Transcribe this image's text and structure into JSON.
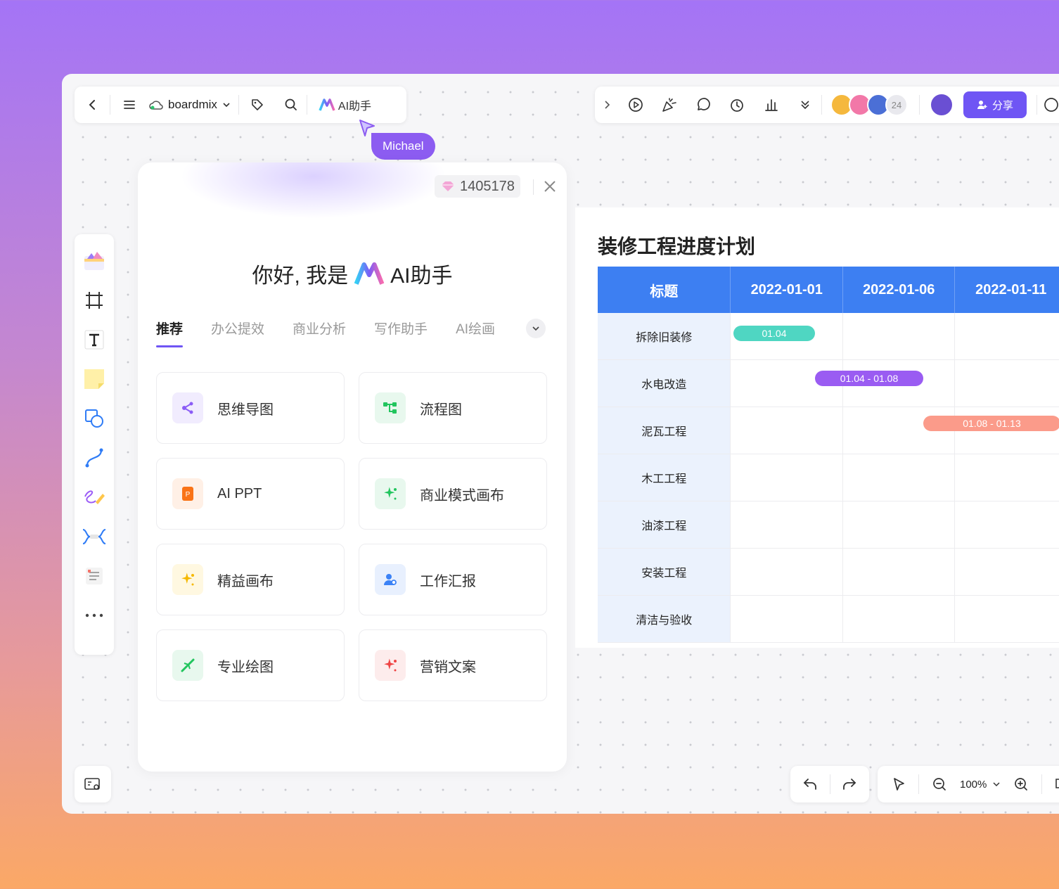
{
  "toolbar": {
    "brand": "boardmix",
    "ai_button_label": "AI助手",
    "share_label": "分享",
    "collaborator_count": "24"
  },
  "cursor": {
    "user_name": "Michael"
  },
  "ai_panel": {
    "credits": "1405178",
    "greeting_prefix": "你好, 我是",
    "greeting_name": "AI助手",
    "tabs": [
      {
        "label": "推荐",
        "active": true
      },
      {
        "label": "办公提效",
        "active": false
      },
      {
        "label": "商业分析",
        "active": false
      },
      {
        "label": "写作助手",
        "active": false
      },
      {
        "label": "AI绘画",
        "active": false
      }
    ],
    "tools": [
      {
        "label": "思维导图",
        "icon": "mindmap-icon",
        "color": "#8b5cf6",
        "bg": "#f1ecfe"
      },
      {
        "label": "流程图",
        "icon": "flowchart-icon",
        "color": "#22c55e",
        "bg": "#e8f8ee"
      },
      {
        "label": "AI PPT",
        "icon": "ppt-icon",
        "color": "#f97316",
        "bg": "#fff0e6"
      },
      {
        "label": "商业模式画布",
        "icon": "sparkle-icon",
        "color": "#22c55e",
        "bg": "#e8f8ee"
      },
      {
        "label": "精益画布",
        "icon": "sparkle-icon",
        "color": "#f5b800",
        "bg": "#fff8e1"
      },
      {
        "label": "工作汇报",
        "icon": "report-icon",
        "color": "#3b82f6",
        "bg": "#e8f0fe"
      },
      {
        "label": "专业绘图",
        "icon": "drawing-icon",
        "color": "#22c55e",
        "bg": "#e8f8ee"
      },
      {
        "label": "营销文案",
        "icon": "sparkle-icon",
        "color": "#ef4444",
        "bg": "#fdecec"
      }
    ]
  },
  "gantt": {
    "title": "装修工程进度计划",
    "header": [
      "标题",
      "2022-01-01",
      "2022-01-06",
      "2022-01-11"
    ],
    "rows": [
      "拆除旧装修",
      "水电改造",
      "泥瓦工程",
      "木工工程",
      "油漆工程",
      "安装工程",
      "清洁与验收"
    ],
    "bars": [
      {
        "label": "01.04",
        "color": "#4fd6c2"
      },
      {
        "label": "01.04 - 01.08",
        "color": "#9a5cf2"
      },
      {
        "label": "01.08 - 01.13",
        "color": "#fb9b8a"
      }
    ]
  },
  "zoom": {
    "level": "100%"
  }
}
